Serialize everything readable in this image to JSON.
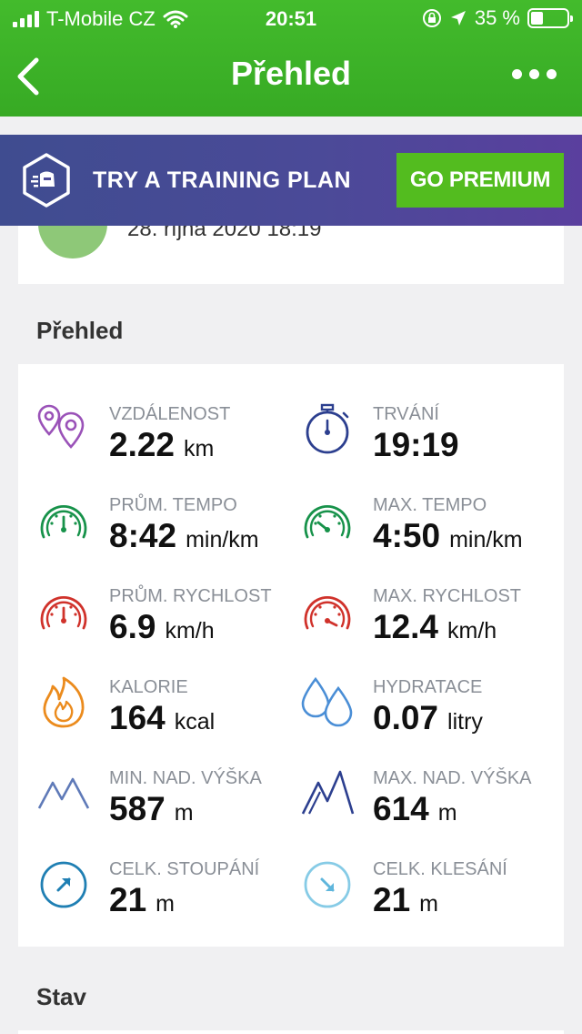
{
  "status_bar": {
    "carrier": "T-Mobile CZ",
    "time": "20:51",
    "battery": "35 %",
    "battery_level": 0.35
  },
  "nav": {
    "title": "Přehled",
    "back_icon": "chevron-left-icon",
    "more_icon": "more-dots-icon"
  },
  "banner": {
    "text": "TRY A TRAINING PLAN",
    "button": "GO PREMIUM",
    "colors": {
      "button": "#53bc1f",
      "background": "#4b4a98"
    }
  },
  "workout": {
    "date": "28. října 2020 18:19"
  },
  "sections": {
    "overview": "Přehled",
    "status": "Stav"
  },
  "stats": [
    {
      "label": "VZDÁLENOST",
      "value": "2.22",
      "unit": "km",
      "icon": "location-pins-icon"
    },
    {
      "label": "TRVÁNÍ",
      "value": "19:19",
      "unit": "",
      "icon": "stopwatch-icon"
    },
    {
      "label": "PRŮM. TEMPO",
      "value": "8:42",
      "unit": "min/km",
      "icon": "avg-pace-gauge-icon"
    },
    {
      "label": "MAX. TEMPO",
      "value": "4:50",
      "unit": "min/km",
      "icon": "max-pace-gauge-icon"
    },
    {
      "label": "PRŮM. RYCHLOST",
      "value": "6.9",
      "unit": "km/h",
      "icon": "avg-speed-gauge-icon"
    },
    {
      "label": "MAX. RYCHLOST",
      "value": "12.4",
      "unit": "km/h",
      "icon": "max-speed-gauge-icon"
    },
    {
      "label": "KALORIE",
      "value": "164",
      "unit": "kcal",
      "icon": "flame-icon"
    },
    {
      "label": "HYDRATACE",
      "value": "0.07",
      "unit": "litry",
      "icon": "water-drops-icon"
    },
    {
      "label": "MIN. NAD. VÝŠKA",
      "value": "587",
      "unit": "m",
      "icon": "min-elevation-mountain-icon"
    },
    {
      "label": "MAX. NAD. VÝŠKA",
      "value": "614",
      "unit": "m",
      "icon": "max-elevation-mountain-icon"
    },
    {
      "label": "CELK. STOUPÁNÍ",
      "value": "21",
      "unit": "m",
      "icon": "ascent-arrow-icon"
    },
    {
      "label": "CELK. KLESÁNÍ",
      "value": "21",
      "unit": "m",
      "icon": "descent-arrow-icon"
    }
  ]
}
